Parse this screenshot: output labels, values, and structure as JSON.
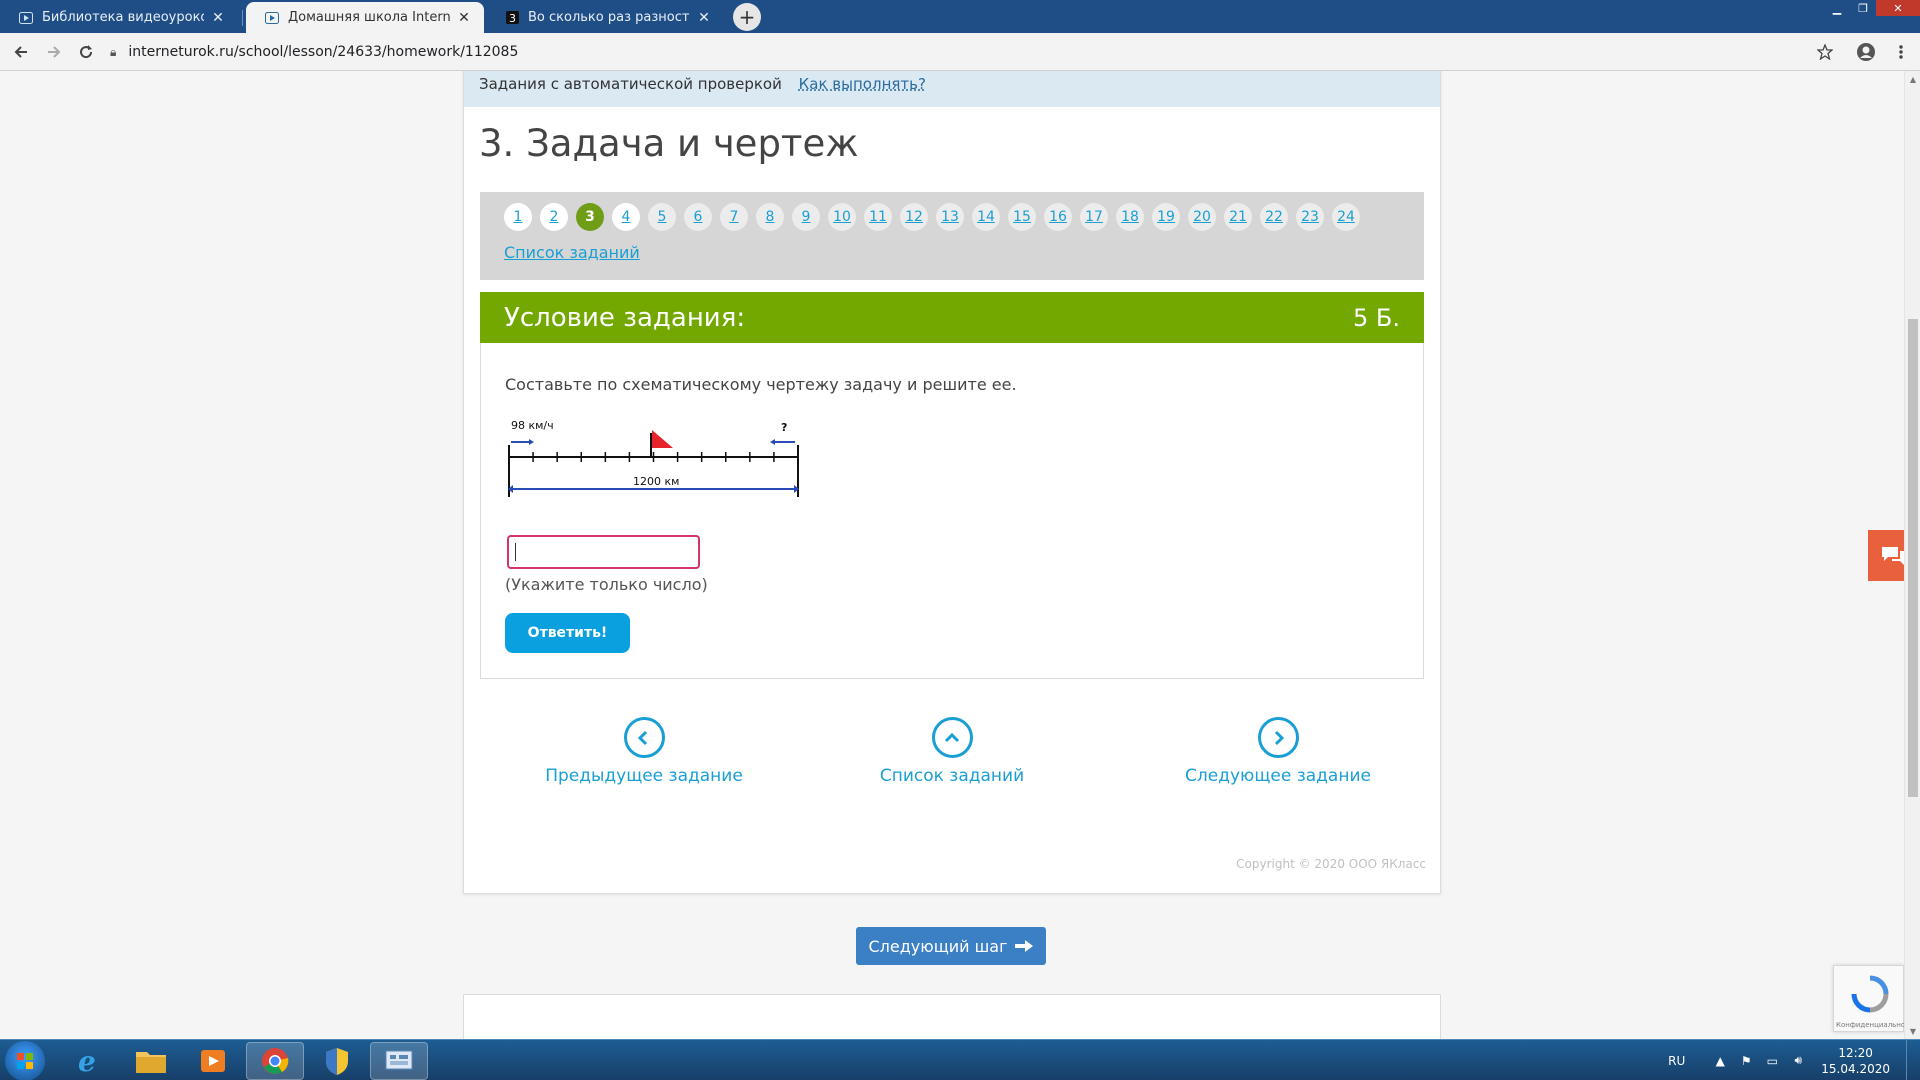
{
  "browser": {
    "tabs": [
      {
        "title": "Библиотека видеоуроков по шк",
        "active": false
      },
      {
        "title": "Домашняя школа InternetUrok.r",
        "active": true
      },
      {
        "title": "Во сколько раз разность чисел",
        "active": false
      }
    ],
    "url": "interneturok.ru/school/lesson/24633/homework/112085"
  },
  "page": {
    "auto_check_label": "Задания с автоматической проверкой",
    "how_link": "Как выполнять?",
    "title": "3. Задача и чертеж",
    "task_numbers": [
      "1",
      "2",
      "3",
      "4",
      "5",
      "6",
      "7",
      "8",
      "9",
      "10",
      "11",
      "12",
      "13",
      "14",
      "15",
      "16",
      "17",
      "18",
      "19",
      "20",
      "21",
      "22",
      "23",
      "24"
    ],
    "current_task": "3",
    "task_list_link": "Список заданий",
    "condition_header": "Условие задания:",
    "points": "5 Б.",
    "condition_text": "Составьте по схематическому чертежу задачу и решите ее.",
    "diagram": {
      "speed_label": "98 км/ч",
      "unknown_label": "?",
      "distance_label": "1200 км"
    },
    "answer_value": "",
    "hint": "(Укажите только число)",
    "submit_label": "Ответить!",
    "nav": {
      "prev": "Предыдущее задание",
      "list": "Список заданий",
      "next": "Следующее задание"
    },
    "copyright": "Copyright © 2020 ООО ЯКласс",
    "next_step": "Следующий шаг",
    "recaptcha_caption": "Конфиденциальность"
  },
  "taskbar": {
    "lang": "RU",
    "time": "12:20",
    "date": "15.04.2020"
  },
  "colors": {
    "accent_green": "#73a800",
    "link_blue": "#1a9fd4",
    "button_blue": "#0aa0e0",
    "next_step_blue": "#3b7fc4",
    "chat_orange": "#e8613c",
    "input_border": "#d6336c"
  }
}
